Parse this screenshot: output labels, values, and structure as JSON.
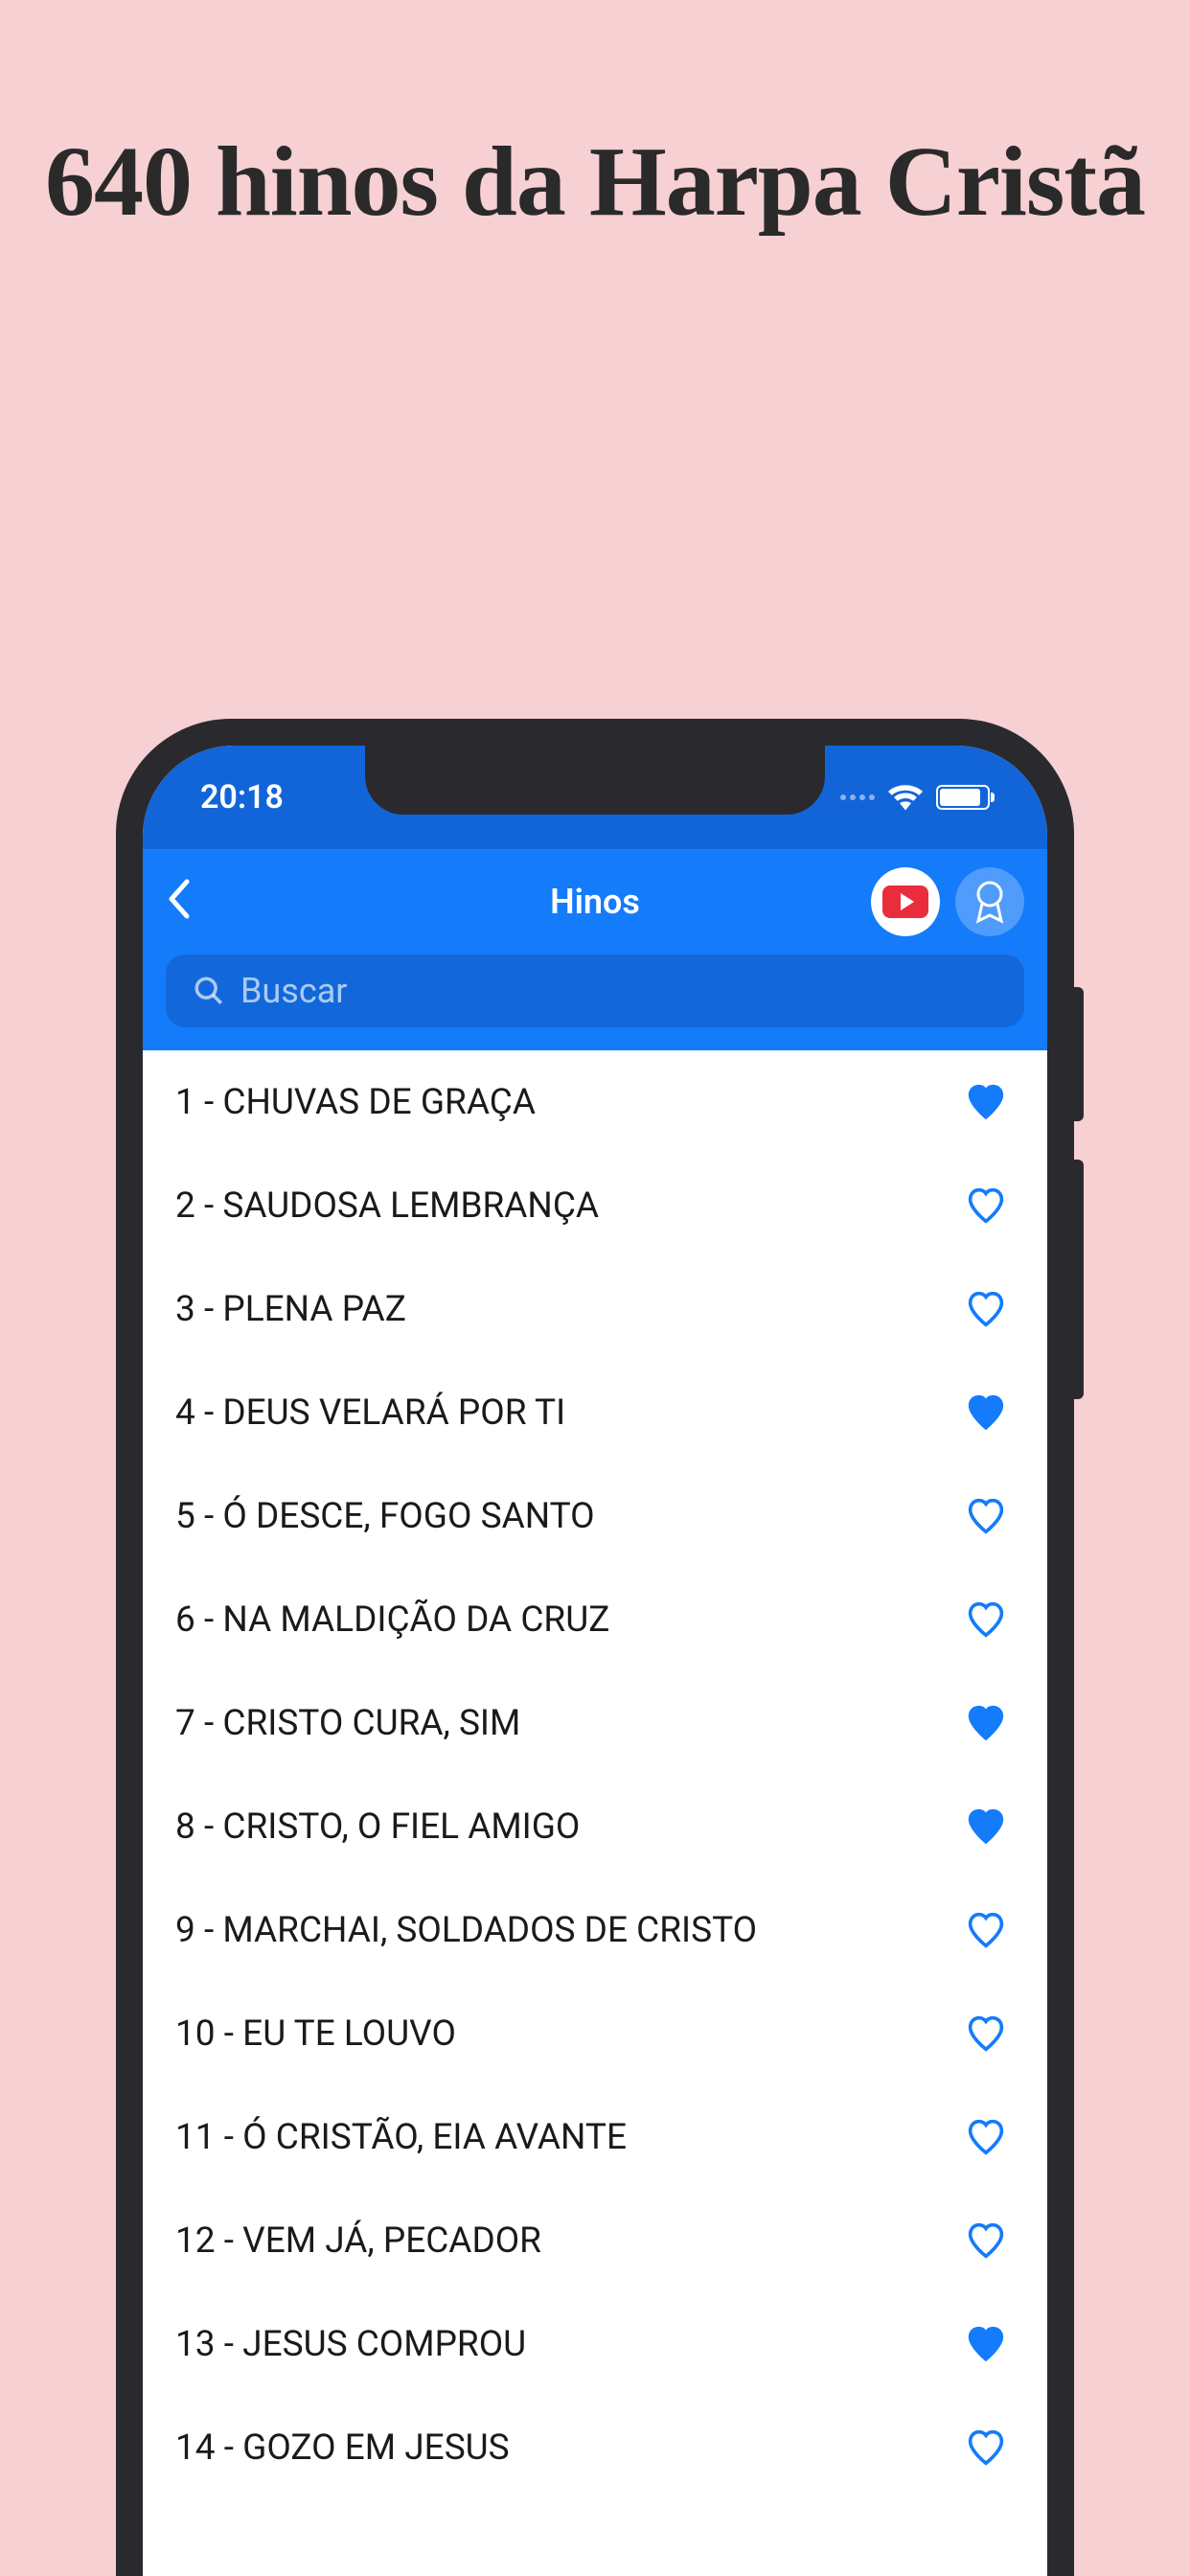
{
  "marketing": {
    "title": "640 hinos da Harpa Cristã"
  },
  "statusBar": {
    "time": "20:18"
  },
  "navBar": {
    "title": "Hinos"
  },
  "search": {
    "placeholder": "Buscar"
  },
  "colors": {
    "heartBlue": "#147bfb",
    "navBlue": "#147bfb",
    "statusBlue": "#1265d8"
  },
  "hymns": [
    {
      "number": 1,
      "title": "CHUVAS DE GRAÇA",
      "favorited": true
    },
    {
      "number": 2,
      "title": "SAUDOSA LEMBRANÇA",
      "favorited": false
    },
    {
      "number": 3,
      "title": "PLENA PAZ",
      "favorited": false
    },
    {
      "number": 4,
      "title": "DEUS VELARÁ POR TI",
      "favorited": true
    },
    {
      "number": 5,
      "title": "Ó DESCE, FOGO SANTO",
      "favorited": false
    },
    {
      "number": 6,
      "title": "NA MALDIÇÃO DA CRUZ",
      "favorited": false
    },
    {
      "number": 7,
      "title": "CRISTO CURA, SIM",
      "favorited": true
    },
    {
      "number": 8,
      "title": "CRISTO, O FIEL AMIGO",
      "favorited": true
    },
    {
      "number": 9,
      "title": "MARCHAI, SOLDADOS DE CRISTO",
      "favorited": false
    },
    {
      "number": 10,
      "title": "EU TE LOUVO",
      "favorited": false
    },
    {
      "number": 11,
      "title": "Ó CRISTÃO, EIA AVANTE",
      "favorited": false
    },
    {
      "number": 12,
      "title": "VEM JÁ, PECADOR",
      "favorited": false
    },
    {
      "number": 13,
      "title": "JESUS COMPROU",
      "favorited": true
    },
    {
      "number": 14,
      "title": "GOZO EM JESUS",
      "favorited": false
    }
  ]
}
